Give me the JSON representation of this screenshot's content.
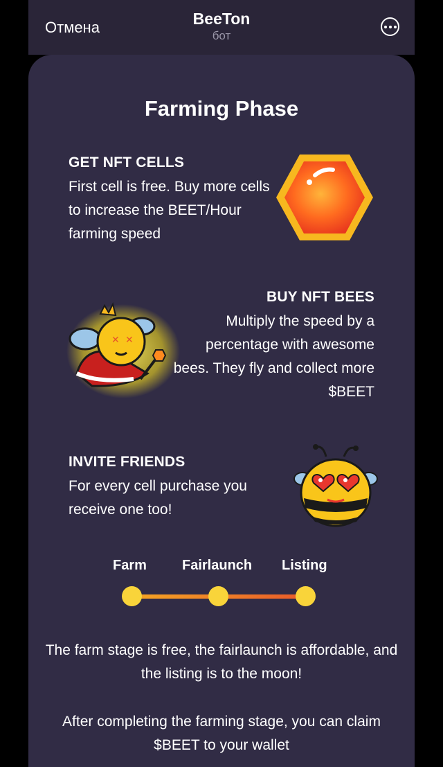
{
  "header": {
    "cancel_label": "Отмена",
    "title": "BeeTon",
    "subtitle": "бот",
    "more_icon": "more-dots-icon"
  },
  "page": {
    "title": "Farming Phase",
    "sections": [
      {
        "heading": "GET NFT CELLS",
        "body": "First cell is free. Buy more cells to increase the BEET/Hour farming speed",
        "image": "honeycomb-cell-icon"
      },
      {
        "heading": "BUY NFT BEES",
        "body": "Multiply the speed by a percentage with awesome bees. They fly and collect more $BEET",
        "image": "king-bee-icon"
      },
      {
        "heading": "INVITE FRIENDS",
        "body": "For every cell purchase you receive one too!",
        "image": "love-bee-icon"
      }
    ],
    "timeline": {
      "stages": [
        "Farm",
        "Fairlaunch",
        "Listing"
      ]
    },
    "paragraph1": "The farm stage is free, the fairlaunch is affordable, and the listing is to the moon!",
    "paragraph2": "After completing the farming stage, you can claim $BEET to your wallet"
  },
  "colors": {
    "header_bg": "#2a2538",
    "sheet_bg": "#312c45",
    "dot": "#f9d43a",
    "bar_start": "#f5a623",
    "bar_end": "#e8572a"
  }
}
